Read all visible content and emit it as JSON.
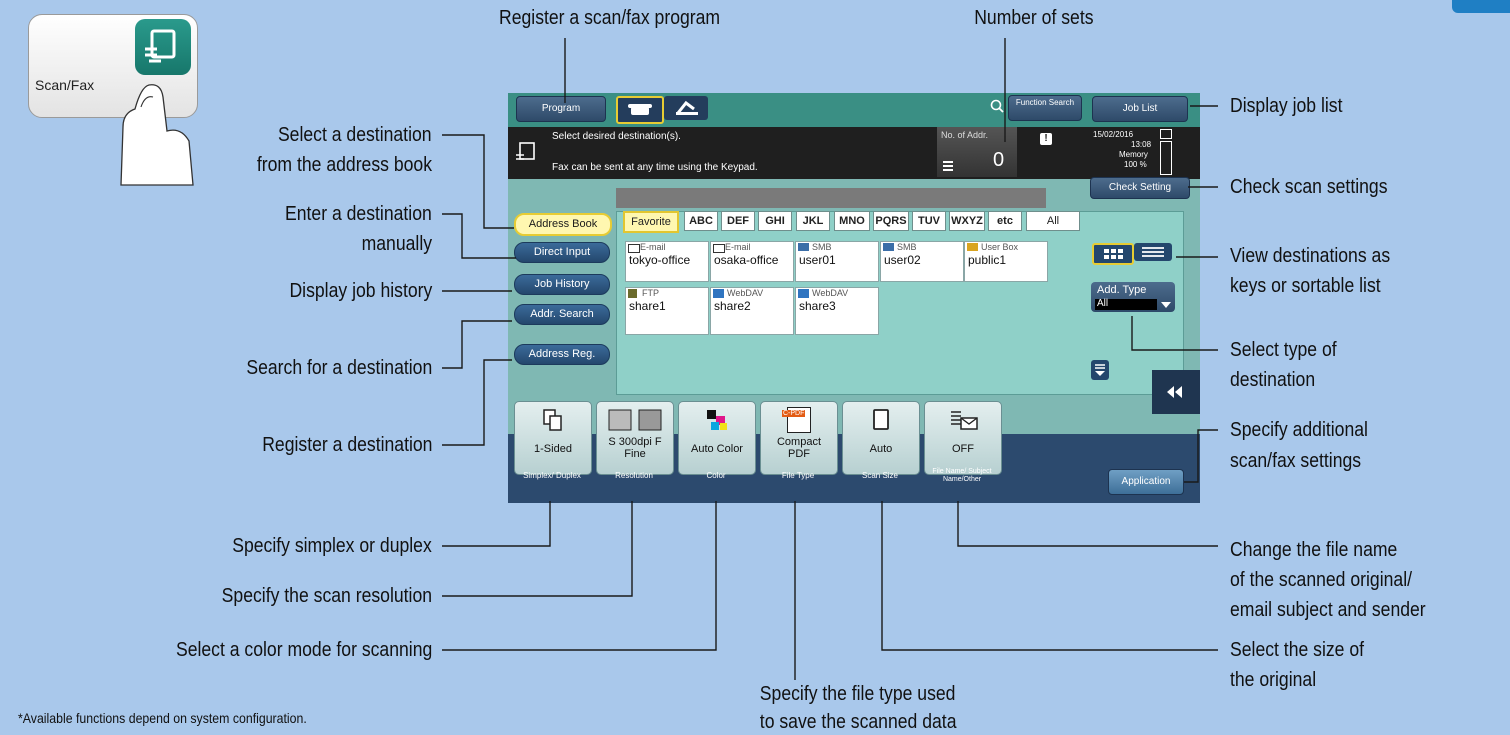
{
  "device": {
    "program_button": "Program",
    "function_search": "Function Search",
    "job_list_button": "Job List",
    "message_line1": "Select desired destination(s).",
    "message_line2": "Fax can be sent at any time using the Keypad.",
    "no_of_addr_label": "No. of Addr.",
    "no_of_addr_value": "0",
    "date": "15/02/2016",
    "time": "13:08",
    "memory_label": "Memory",
    "memory_value": "100 %",
    "check_setting_button": "Check Setting",
    "tabs": [
      "Address Book",
      "Direct Input",
      "Job History",
      "Addr. Search",
      "Address Reg."
    ],
    "index_tabs": [
      "Favorite",
      "ABC",
      "DEF",
      "GHI",
      "JKL",
      "MNO",
      "PQRS",
      "TUV",
      "WXYZ",
      "etc",
      "All"
    ],
    "destinations": [
      {
        "type": "E-mail",
        "name": "tokyo-office"
      },
      {
        "type": "E-mail",
        "name": "osaka-office"
      },
      {
        "type": "SMB",
        "name": "user01"
      },
      {
        "type": "SMB",
        "name": "user02"
      },
      {
        "type": "User Box",
        "name": "public1"
      },
      {
        "type": "FTP",
        "name": "share1"
      },
      {
        "type": "WebDAV",
        "name": "share2"
      },
      {
        "type": "WebDAV",
        "name": "share3"
      }
    ],
    "add_type_label": "Add. Type",
    "add_type_value": "All",
    "function_keys": [
      {
        "value": "1-Sided",
        "label": "Simplex/ Duplex"
      },
      {
        "value": "S 300dpi F Fine",
        "label": "Resolution"
      },
      {
        "value": "Auto Color",
        "label": "Color"
      },
      {
        "value": "Compact PDF",
        "label": "File Type"
      },
      {
        "value": "Auto",
        "label": "Scan Size"
      },
      {
        "value": "OFF",
        "label": "File Name/ Subject Name/Other"
      }
    ],
    "application_button": "Application",
    "scanfax_key_label": "Scan/Fax",
    "pdf_badge": "C-PDF"
  },
  "callouts": {
    "register_program": "Register a scan/fax program",
    "number_of_sets": "Number of sets",
    "display_job_list": "Display job list",
    "select_from_address_book_1": "Select a destination",
    "select_from_address_book_2": "from the address book",
    "enter_destination_1": "Enter a destination",
    "enter_destination_2": "manually",
    "display_job_history": "Display job history",
    "search_destination": "Search for a destination",
    "register_destination": "Register a destination",
    "check_scan_settings": "Check scan settings",
    "view_destinations_1": "View destinations as",
    "view_destinations_2": "keys or sortable list",
    "select_type_1": "Select type of",
    "select_type_2": "destination",
    "additional_settings_1": "Specify additional",
    "additional_settings_2": "scan/fax settings",
    "simplex_duplex": "Specify simplex or duplex",
    "scan_resolution": "Specify the scan resolution",
    "color_mode": "Select a color mode for scanning",
    "file_type_1": "Specify the file type used",
    "file_type_2": "to save the scanned data",
    "file_name_1": "Change the file name",
    "file_name_2": "of the scanned original/",
    "file_name_3": "email subject and sender",
    "original_size_1": "Select the size of",
    "original_size_2": "the original"
  },
  "footnote": "*Available functions depend on system configuration."
}
